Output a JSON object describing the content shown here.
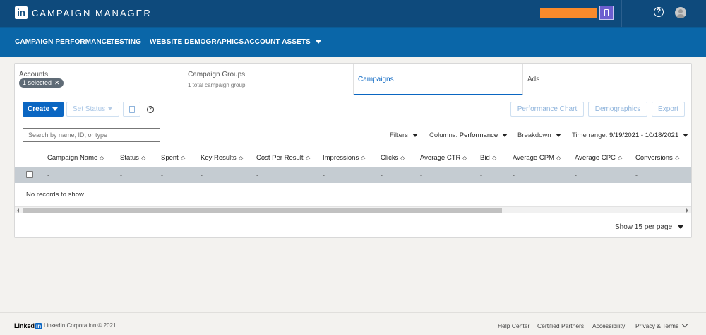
{
  "header": {
    "logo": "in",
    "title": "CAMPAIGN MANAGER",
    "help_glyph": "?"
  },
  "nav": {
    "items": [
      "CAMPAIGN PERFORMANCE",
      "TESTING",
      "WEBSITE DEMOGRAPHICS",
      "ACCOUNT ASSETS"
    ]
  },
  "tabs": {
    "accounts": {
      "label": "Accounts",
      "pill": "1 selected",
      "pill_x": "✕"
    },
    "campaign_groups": {
      "label": "Campaign Groups",
      "sub": "1 total campaign group"
    },
    "campaigns": {
      "label": "Campaigns"
    },
    "ads": {
      "label": "Ads"
    }
  },
  "toolbar": {
    "create": "Create",
    "set_status": "Set Status",
    "help_glyph": "?",
    "performance_chart": "Performance Chart",
    "demographics": "Demographics",
    "export": "Export"
  },
  "search": {
    "placeholder": "Search by name, ID, or type"
  },
  "filters": {
    "filters": "Filters",
    "columns_label": "Columns:",
    "columns_value": "Performance",
    "breakdown": "Breakdown",
    "time_label": "Time range:",
    "time_value": "9/19/2021 - 10/18/2021"
  },
  "table": {
    "columns": [
      "Campaign Name",
      "Status",
      "Spent",
      "Key Results",
      "Cost Per Result",
      "Impressions",
      "Clicks",
      "Average CTR",
      "Bid",
      "Average CPM",
      "Average CPC",
      "Conversions"
    ],
    "summary_cell": "-",
    "empty": "No records to show",
    "sort_glyph": "◇"
  },
  "pagination": {
    "per_page": "Show 15 per page"
  },
  "footer": {
    "logo_text": "Linked",
    "logo_in": "in",
    "copyright": "LinkedIn Corporation © 2021",
    "links": [
      "Help Center",
      "Certified Partners",
      "Accessibility",
      "Privacy & Terms"
    ]
  },
  "colors": {
    "header": "#0e4a7c",
    "nav": "#0a66a8",
    "primary": "#0a66c2",
    "redaction": "#f98a2b"
  }
}
